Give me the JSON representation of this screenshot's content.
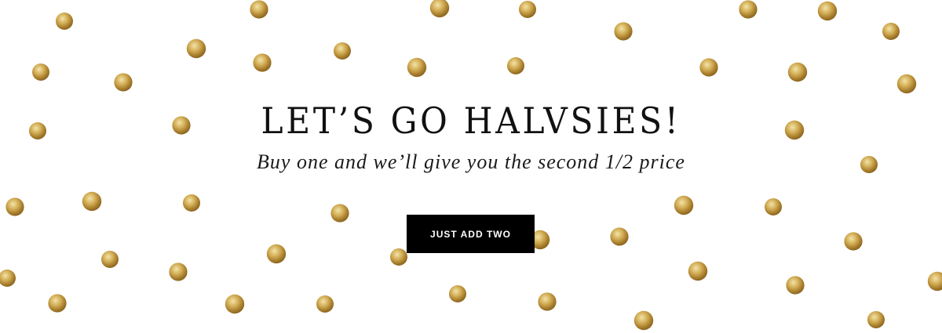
{
  "banner": {
    "headline": "LET’S GO HALVSIES!",
    "subhead": "Buy one and we’ll give you the second 1/2 price",
    "cta_label": "JUST ADD TWO",
    "colors": {
      "background": "#ffffff",
      "text": "#111111",
      "button_bg": "#000000",
      "button_text": "#ffffff",
      "glitter_gold": "#c9a24a"
    },
    "decoration": "gold-glitter-polka-dots"
  }
}
